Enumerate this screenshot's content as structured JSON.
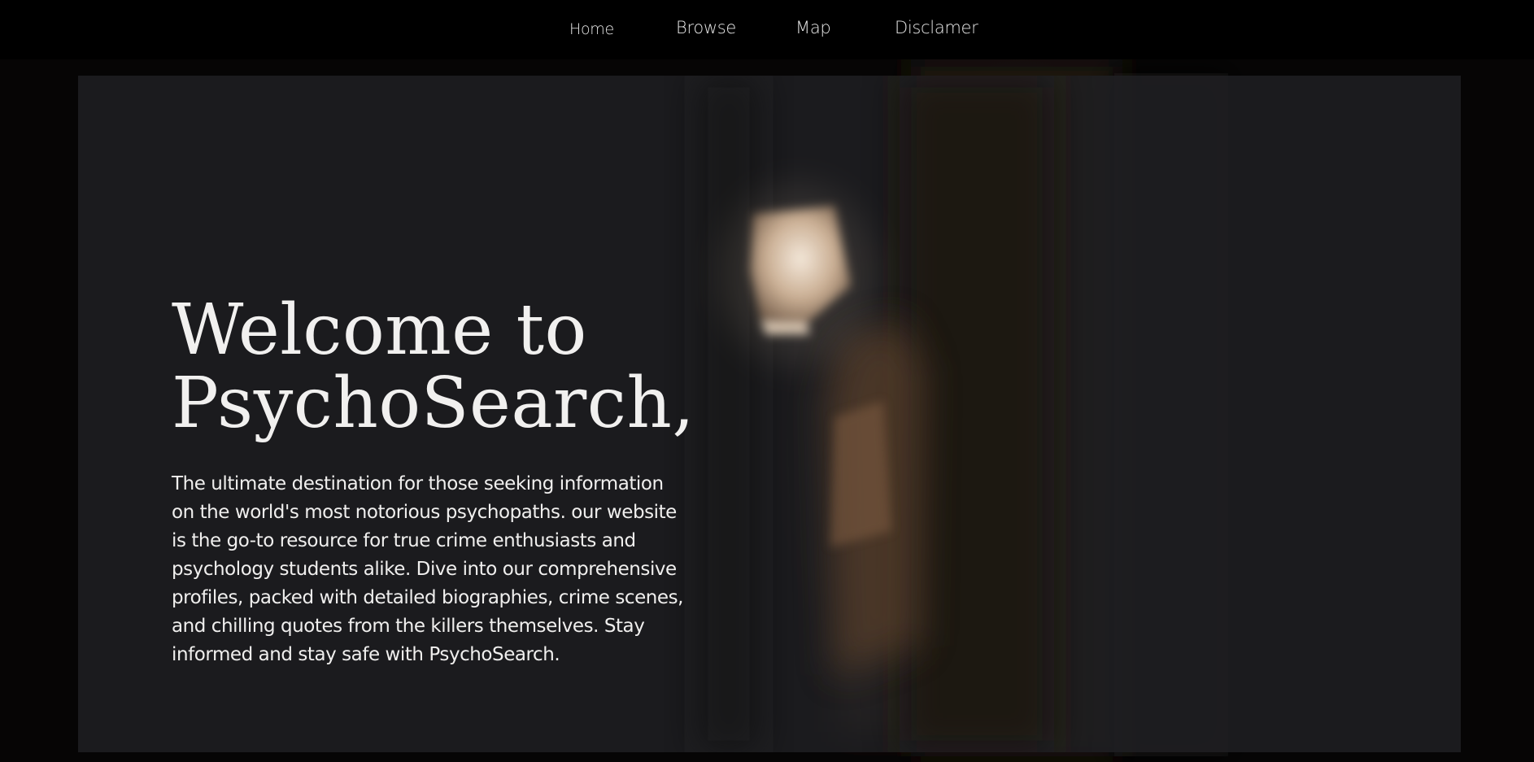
{
  "nav": {
    "items": [
      {
        "label": "Home"
      },
      {
        "label": "Browse"
      },
      {
        "label": "Map"
      },
      {
        "label": "Disclamer"
      }
    ]
  },
  "hero": {
    "title_line1": "Welcome to",
    "title_line2": "PsychoSearch,",
    "description": "The ultimate destination for those seeking information on the world's most notorious psychopaths. our website is the go-to resource for true crime enthusiasts and psychology students alike. Dive into our comprehensive profiles, packed with detailed biographies, crime scenes, and chilling quotes from the killers themselves. Stay informed and stay safe with PsychoSearch.",
    "background_image": "dark-lantern-wall-photo"
  },
  "colors": {
    "page_background": "#000000",
    "hero_overlay": "#202023",
    "text": "#f0efee",
    "lantern_glow": "#f3e6d6"
  }
}
